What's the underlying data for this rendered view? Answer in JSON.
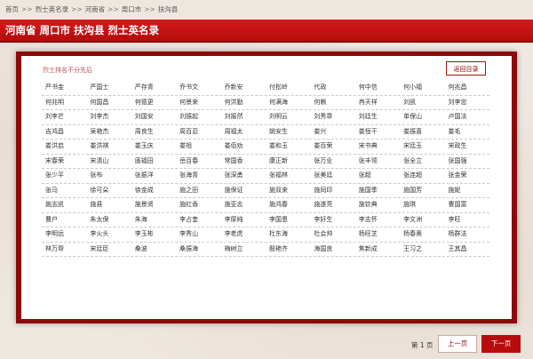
{
  "breadcrumb": [
    {
      "label": "首页"
    },
    {
      "label": "烈士英名录"
    },
    {
      "label": "河南省"
    },
    {
      "label": "周口市"
    },
    {
      "label": "扶沟县"
    }
  ],
  "breadcrumb_sep": ">>",
  "banner": {
    "title": "河南省 周口市 扶沟县 烈士英名录"
  },
  "note": "烈士排名不分先后",
  "back_button": "返回目录",
  "names": [
    [
      "严书金",
      "严国士",
      "严存青",
      "乔书文",
      "乔新安",
      "付松岭",
      "代政",
      "何中信",
      "何小福",
      "何兆昌"
    ],
    [
      "何兆明",
      "何国昌",
      "何德更",
      "何景来",
      "何洪勤",
      "何满海",
      "何赖",
      "冉天祥",
      "刘凯",
      "刘李忠"
    ],
    [
      "刘李芒",
      "刘李杰",
      "刘国安",
      "刘振起",
      "刘振然",
      "刘明云",
      "刘秀章",
      "刘廷生",
      "单保山",
      "卢国法"
    ],
    [
      "吉鸿昌",
      "吴艳杰",
      "周良生",
      "周百忍",
      "周福太",
      "姚安生",
      "娄兴",
      "娄恒干",
      "娄振喜",
      "娄毛"
    ],
    [
      "娄洪启",
      "娄洪祺",
      "娄玉庆",
      "娄祖",
      "娄佰劝",
      "娄和玉",
      "娄百荣",
      "宋书典",
      "宋廷玉",
      "宋政生"
    ],
    [
      "宋春荣",
      "宋清山",
      "唐福田",
      "岳百春",
      "常国香",
      "康正新",
      "张万业",
      "张丰领",
      "张全立",
      "张国强"
    ],
    [
      "张少平",
      "张布",
      "张振洋",
      "张海青",
      "张深勇",
      "张福林",
      "张美廷",
      "张超",
      "张连超",
      "张金荣"
    ],
    [
      "张马",
      "徐可朵",
      "徐金成",
      "施之田",
      "施保证",
      "施双来",
      "施同印",
      "施国季",
      "施国芳",
      "施妮"
    ],
    [
      "施志凯",
      "施县",
      "施景贤",
      "施红香",
      "施亚志",
      "施鸿春",
      "施遂亮",
      "施钦典",
      "施琪",
      "曹国富"
    ],
    [
      "曹户",
      "朱太保",
      "朱海",
      "李占奎",
      "李厚纯",
      "李国恩",
      "李好生",
      "李志怀",
      "李文洲",
      "李旺"
    ],
    [
      "李明远",
      "李火头",
      "李玉彬",
      "李秀山",
      "李老虎",
      "杜东海",
      "杜会帅",
      "杨旺芝",
      "杨春奥",
      "杨群法"
    ],
    [
      "林万帮",
      "宋廷臣",
      "桑波",
      "桑振海",
      "梅树立",
      "殷艳齐",
      "海国良",
      "焦新成",
      "王习之",
      "王其昌"
    ]
  ],
  "pager": {
    "page_info": "第 1 页",
    "prev_label": "上一页",
    "next_label": "下一页"
  }
}
